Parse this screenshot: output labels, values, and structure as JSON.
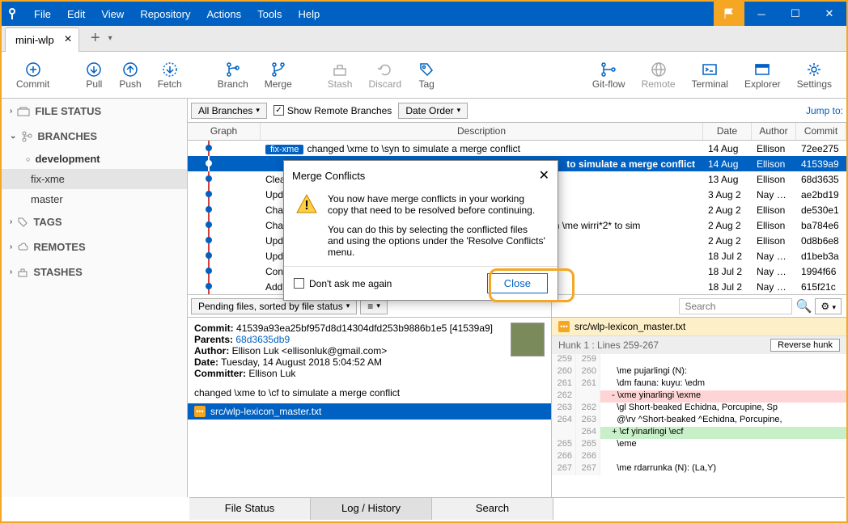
{
  "menu": {
    "file": "File",
    "edit": "Edit",
    "view": "View",
    "repository": "Repository",
    "actions": "Actions",
    "tools": "Tools",
    "help": "Help"
  },
  "tab": {
    "name": "mini-wlp"
  },
  "toolbar": {
    "commit": "Commit",
    "pull": "Pull",
    "push": "Push",
    "fetch": "Fetch",
    "branch": "Branch",
    "merge": "Merge",
    "stash": "Stash",
    "discard": "Discard",
    "tag": "Tag",
    "gitflow": "Git-flow",
    "remote": "Remote",
    "terminal": "Terminal",
    "explorer": "Explorer",
    "settings": "Settings"
  },
  "sidebar": {
    "file_status": "FILE STATUS",
    "branches": "BRANCHES",
    "tags": "TAGS",
    "remotes": "REMOTES",
    "stashes": "STASHES",
    "branch_items": [
      "development",
      "fix-xme",
      "master"
    ]
  },
  "filters": {
    "all_branches": "All Branches",
    "show_remote": "Show Remote Branches",
    "date_order": "Date Order",
    "jump": "Jump to:"
  },
  "grid": {
    "headers": {
      "graph": "Graph",
      "desc": "Description",
      "date": "Date",
      "author": "Author",
      "commit": "Commit"
    },
    "rows": [
      {
        "branch": "fix-xme",
        "desc": "changed \\xme to \\syn to simulate a merge conflict",
        "date": "14 Aug",
        "author": "Ellison",
        "commit": "72ee275",
        "sel": false
      },
      {
        "desc": "to simulate a merge conflict",
        "date": "14 Aug",
        "author": "Ellison",
        "commit": "41539a9",
        "sel": true
      },
      {
        "desc": "Clea",
        "date": "13 Aug",
        "author": "Ellison",
        "commit": "68d3635",
        "sel": false
      },
      {
        "desc": "Upd",
        "date": "3 Aug 2",
        "author": "Nay Sar",
        "commit": "ae2bd19",
        "sel": false
      },
      {
        "desc": "Cha",
        "date": "2 Aug 2",
        "author": "Ellison",
        "commit": "de530e1",
        "sel": false
      },
      {
        "desc": "Cha",
        "desc2": "reversals in \\me wirri*2* to sim",
        "date": "2 Aug 2",
        "author": "Ellison",
        "commit": "ba784e6",
        "sel": false
      },
      {
        "desc": "Upd",
        "date": "2 Aug 2",
        "author": "Ellison",
        "commit": "0d8b6e8",
        "sel": false
      },
      {
        "desc": "Upd",
        "date": "18 Jul 2",
        "author": "Nay Sar",
        "commit": "d1beb3a",
        "sel": false
      },
      {
        "desc": "Con",
        "date": "18 Jul 2",
        "author": "Nay Sar",
        "commit": "1994f66",
        "sel": false
      },
      {
        "desc": "Add",
        "date": "18 Jul 2",
        "author": "Nay Sar",
        "commit": "615f21c",
        "sel": false
      }
    ]
  },
  "pending": {
    "label": "Pending files, sorted by file status"
  },
  "commit_info": {
    "commit_label": "Commit:",
    "commit": "41539a93ea25bf957d8d14304dfd253b9886b1e5 [41539a9]",
    "parents_label": "Parents:",
    "parents": "68d3635db9",
    "author_label": "Author:",
    "author": "Ellison Luk <ellisonluk@gmail.com>",
    "date_label": "Date:",
    "date": "Tuesday, 14 August 2018 5:04:52 AM",
    "committer_label": "Committer:",
    "committer": "Ellison Luk",
    "message": "changed \\xme to \\cf to simulate a merge conflict",
    "file": "src/wlp-lexicon_master.txt"
  },
  "search": {
    "placeholder": "Search"
  },
  "diff": {
    "file": "src/wlp-lexicon_master.txt",
    "hunk": "Hunk 1 : Lines 259-267",
    "reverse": "Reverse hunk",
    "lines": [
      {
        "a": "259",
        "b": "259",
        "t": "",
        "c": ""
      },
      {
        "a": "260",
        "b": "260",
        "t": "",
        "c": "    \\me pujarlingi (N):"
      },
      {
        "a": "261",
        "b": "261",
        "t": "",
        "c": "    \\dm fauna: kuyu: \\edm"
      },
      {
        "a": "262",
        "b": "",
        "t": "del",
        "c": "  - \\xme yinarlingi \\exme"
      },
      {
        "a": "263",
        "b": "262",
        "t": "",
        "c": "    \\gl Short-beaked Echidna, Porcupine, Sp"
      },
      {
        "a": "264",
        "b": "263",
        "t": "",
        "c": "    @\\rv ^Short-beaked ^Echidna, Porcupine,"
      },
      {
        "a": "",
        "b": "264",
        "t": "add",
        "c": "  + \\cf yinarlingi \\ecf"
      },
      {
        "a": "265",
        "b": "265",
        "t": "",
        "c": "    \\eme"
      },
      {
        "a": "266",
        "b": "266",
        "t": "",
        "c": ""
      },
      {
        "a": "267",
        "b": "267",
        "t": "",
        "c": "    \\me rdarrunka (N): (La,Y)"
      }
    ]
  },
  "statusbar": {
    "file_status": "File Status",
    "log": "Log / History",
    "search": "Search"
  },
  "dialog": {
    "title": "Merge Conflicts",
    "body1": "You now have merge conflicts in your working copy that need to be resolved before continuing.",
    "body2": "You can do this by selecting the conflicted files and using the options under the 'Resolve Conflicts' menu.",
    "dont_ask": "Don't ask me again",
    "close": "Close"
  }
}
